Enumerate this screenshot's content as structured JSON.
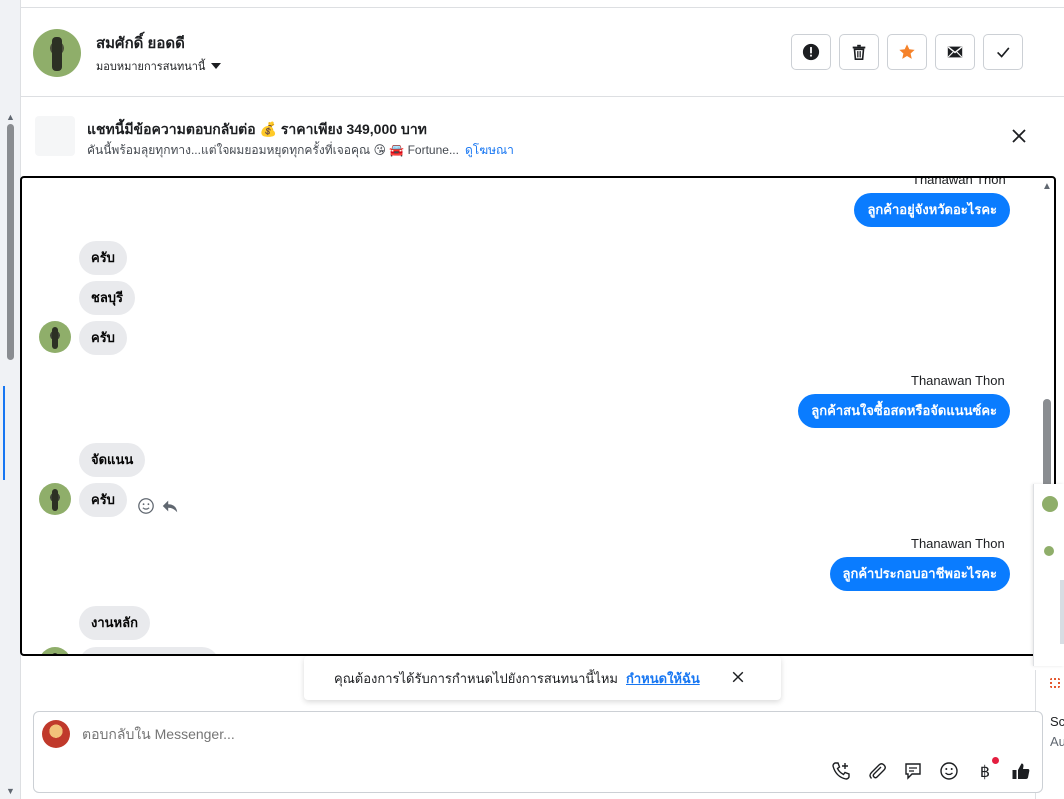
{
  "header": {
    "user_name": "สมศักดิ์ ยอดดี",
    "assign_label": "มอบหมายการสนทนานี้",
    "actions": [
      "report",
      "delete",
      "star",
      "mark-unread",
      "done"
    ],
    "star_color": "#f5822a"
  },
  "ad": {
    "title": "แชทนี้มีข้อความตอบกลับต่อ 💰 ราคาเพียง 349,000 บาท",
    "subtitle": "คันนี้พร้อมลุยทุกทาง...แต่ใจผมยอมหยุดทุกครั้งที่เจอคุณ 😘 🚘 Fortune...",
    "link": "ดูโฆษณา"
  },
  "chat": {
    "messages": [
      {
        "direction": "out",
        "sender": "Thanawan Thon",
        "text": "ลูกค้าอยู่จังหวัดอะไรคะ"
      },
      {
        "direction": "in",
        "text": "ครับ"
      },
      {
        "direction": "in",
        "text": "ชลบุรี"
      },
      {
        "direction": "in",
        "text": "ครับ"
      },
      {
        "direction": "out",
        "sender": "Thanawan Thon",
        "text": "ลูกค้าสนใจซื้อสดหรือจัดแนนซ์คะ"
      },
      {
        "direction": "in",
        "text": "จัดแนน"
      },
      {
        "direction": "in",
        "text": "ครับ"
      },
      {
        "direction": "out",
        "sender": "Thanawan Thon",
        "text": "ลูกค้าประกอบอาชีพอะไรคะ"
      },
      {
        "direction": "in",
        "text": "งานหลัก"
      }
    ],
    "outgoing_color": "#0a7cff",
    "incoming_color": "#e9eaed"
  },
  "reminder": {
    "text": "คุณต้องการได้รับการกำหนดไปยังการสนทนานี้ไหม",
    "link": "กำหนดให้ฉัน"
  },
  "composer": {
    "placeholder": "ตอบกลับใน Messenger...",
    "tools": [
      "call-add-icon",
      "attachment-icon",
      "saved-reply-icon",
      "emoji-icon",
      "baht-icon",
      "like-icon"
    ]
  },
  "peek": {
    "line1": "Sc",
    "line2": "Au"
  }
}
